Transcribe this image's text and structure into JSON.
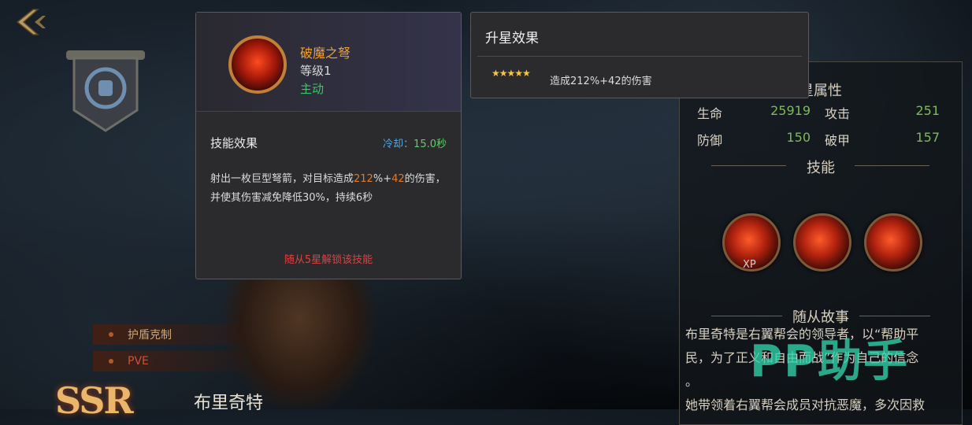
{
  "skill_popup": {
    "name": "破魔之弩",
    "level": "等级1",
    "type": "主动",
    "effect_title": "技能效果",
    "cooldown_label": "冷却：",
    "cooldown_value": "15.0秒",
    "desc_1": "射出一枚巨型弩箭，对目标造成",
    "desc_pct": "212",
    "desc_2": "%+",
    "desc_flat": "42",
    "desc_3": "的伤害，并使其伤害减免降低30%，持续6秒",
    "unlock": "随从5星解锁该技能"
  },
  "star_popup": {
    "title": "升星效果",
    "stars": "★★★★★",
    "desc": "造成212%+42的伤害"
  },
  "attributes": {
    "title": "星属性",
    "rows": [
      {
        "k1": "生命",
        "v1": "25919",
        "k2": "攻击",
        "v2": "251"
      },
      {
        "k1": "防御",
        "v1": "150",
        "k2": "破甲",
        "v2": "157"
      }
    ]
  },
  "skills_section": {
    "title": "技能",
    "xp_label": "XP"
  },
  "story": {
    "title": "随从故事",
    "lines": [
      "布里奇特是右翼帮会的领导者，以“帮助平",
      "民，为了正义和自由而战”作为自己的信念",
      "。",
      "她带领着右翼帮会成员对抗恶魔，多次因救"
    ]
  },
  "tags": [
    "护盾克制",
    "PVE"
  ],
  "rarity": "SSR",
  "hero_name": "布里奇特",
  "watermark": "PP助手",
  "icons": [
    "back-arrow-icon",
    "fist-emblem-icon",
    "crossbow-bolt-icon"
  ]
}
